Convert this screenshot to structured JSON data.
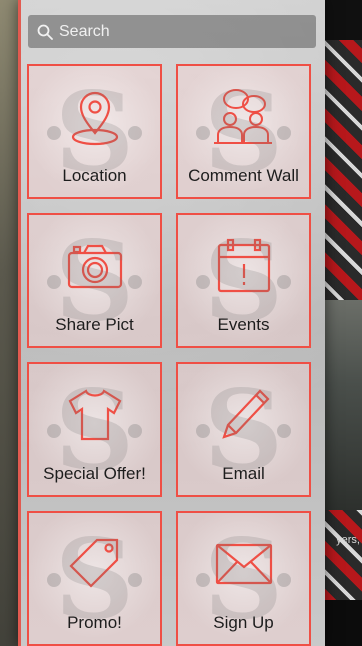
{
  "search": {
    "placeholder": "Search"
  },
  "background": {
    "caption": "yers,"
  },
  "menu": {
    "tiles": [
      {
        "label": "Location",
        "icon": "location-pin-icon"
      },
      {
        "label": "Comment Wall",
        "icon": "people-chat-icon"
      },
      {
        "label": "Share Pict",
        "icon": "camera-icon"
      },
      {
        "label": "Events",
        "icon": "calendar-icon"
      },
      {
        "label": "Special Offer!",
        "icon": "tshirt-icon"
      },
      {
        "label": "Email",
        "icon": "pencil-icon"
      },
      {
        "label": "Promo!",
        "icon": "tag-icon"
      },
      {
        "label": "Sign Up",
        "icon": "envelope-icon"
      }
    ]
  },
  "colors": {
    "accent": "#ef4f45",
    "label": "#1d1d1d"
  }
}
